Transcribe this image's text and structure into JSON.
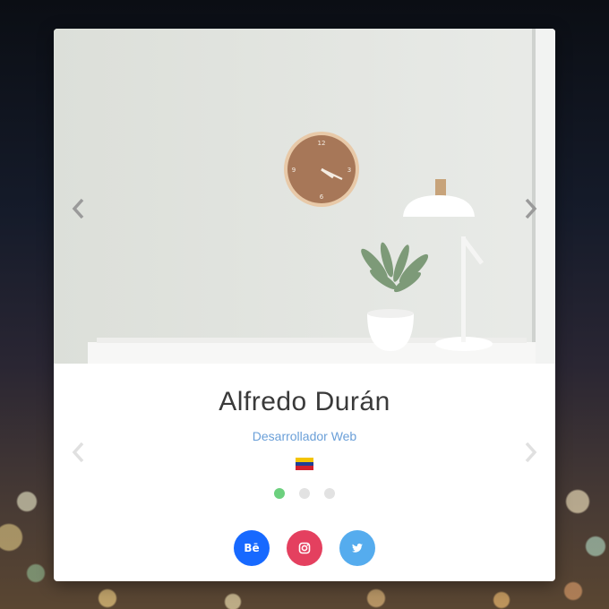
{
  "profile": {
    "name": "Alfredo Durán",
    "role": "Desarrollador Web"
  },
  "flag": {
    "icon": "venezuela-flag-icon",
    "colors": [
      "#f4c400",
      "#1f3f95",
      "#d21f2c"
    ]
  },
  "carousel": {
    "slide_count": 3,
    "active_index": 0,
    "active_color": "#6cd07e",
    "inactive_color": "#e2e2e2"
  },
  "social": [
    {
      "icon": "behance-icon",
      "glyph": "Bē",
      "color": "#1769ff"
    },
    {
      "icon": "instagram-icon",
      "glyph": "",
      "color": "#e4405f"
    },
    {
      "icon": "twitter-icon",
      "glyph": "",
      "color": "#55acee"
    }
  ],
  "icons": {
    "prev": "chevron-left-icon",
    "next": "chevron-right-icon"
  }
}
